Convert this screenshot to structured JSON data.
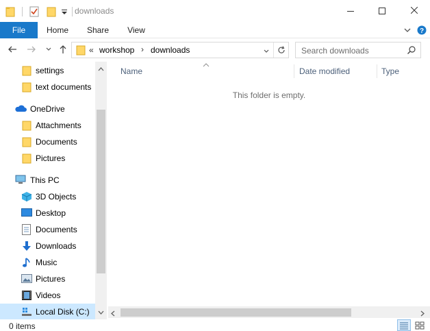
{
  "window": {
    "title": "downloads"
  },
  "caption": {
    "minimize": "—",
    "maximize": "☐",
    "close": "✕"
  },
  "ribbon": {
    "file": "File",
    "home": "Home",
    "share": "Share",
    "view": "View",
    "expand_glyph": "⌄",
    "help_glyph": "?"
  },
  "nav": {
    "back": "←",
    "forward": "→",
    "recent": "⌄",
    "up": "↑",
    "breadcrumb": {
      "overflow": "«",
      "items": [
        "workshop",
        "downloads"
      ],
      "sep": "›"
    },
    "refresh": "↻",
    "search_placeholder": "Search downloads"
  },
  "sidebar": {
    "items": [
      {
        "label": "settings",
        "icon": "folder-icon"
      },
      {
        "label": "text documents",
        "icon": "folder-icon"
      },
      {
        "label": "OneDrive",
        "icon": "onedrive-cloud-icon"
      },
      {
        "label": "Attachments",
        "icon": "folder-icon"
      },
      {
        "label": "Documents",
        "icon": "folder-icon"
      },
      {
        "label": "Pictures",
        "icon": "folder-icon"
      },
      {
        "label": "This PC",
        "icon": "monitor-icon"
      },
      {
        "label": "3D Objects",
        "icon": "cube-icon"
      },
      {
        "label": "Desktop",
        "icon": "desktop-icon"
      },
      {
        "label": "Documents",
        "icon": "document-icon"
      },
      {
        "label": "Downloads",
        "icon": "download-arrow-icon"
      },
      {
        "label": "Music",
        "icon": "music-note-icon"
      },
      {
        "label": "Pictures",
        "icon": "pictures-icon"
      },
      {
        "label": "Videos",
        "icon": "film-icon"
      },
      {
        "label": "Local Disk (C:)",
        "icon": "disk-drive-icon"
      }
    ]
  },
  "content": {
    "columns": [
      "Name",
      "Date modified",
      "Type"
    ],
    "sort_glyph": "^",
    "empty_message": "This folder is empty."
  },
  "status": {
    "items": "0 items"
  },
  "colors": {
    "accent": "#1979ca",
    "selected": "#cce8ff",
    "folder": "#ffd768"
  }
}
